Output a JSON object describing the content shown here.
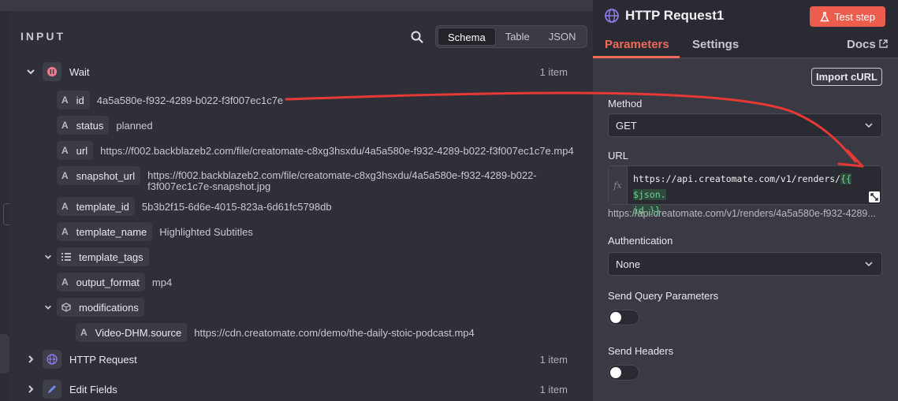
{
  "input_panel": {
    "title": "INPUT",
    "view_modes": [
      "Schema",
      "Table",
      "JSON"
    ],
    "active_view": "Schema",
    "nodes": [
      {
        "label": "Wait",
        "count": "1 item",
        "expanded": true
      },
      {
        "label": "HTTP Request",
        "count": "1 item",
        "expanded": false
      },
      {
        "label": "Edit Fields",
        "count": "1 item",
        "expanded": false
      }
    ],
    "fields": {
      "id": {
        "key": "id",
        "type": "A",
        "value": "4a5a580e-f932-4289-b022-f3f007ec1c7e"
      },
      "status": {
        "key": "status",
        "type": "A",
        "value": "planned"
      },
      "url": {
        "key": "url",
        "type": "A",
        "value": "https://f002.backblazeb2.com/file/creatomate-c8xg3hsxdu/4a5a580e-f932-4289-b022-f3f007ec1c7e.mp4"
      },
      "snapshot_url": {
        "key": "snapshot_url",
        "type": "A",
        "value_line1": "https://f002.backblazeb2.com/file/creatomate-c8xg3hsxdu/4a5a580e-f932-4289-b022-",
        "value_line2": "f3f007ec1c7e-snapshot.jpg"
      },
      "template_id": {
        "key": "template_id",
        "type": "A",
        "value": "5b3b2f15-6d6e-4015-823a-6d61fc5798db"
      },
      "template_name": {
        "key": "template_name",
        "type": "A",
        "value": "Highlighted Subtitles"
      },
      "template_tags": {
        "key": "template_tags"
      },
      "output_format": {
        "key": "output_format",
        "type": "A",
        "value": "mp4"
      },
      "modifications": {
        "key": "modifications"
      },
      "video_source": {
        "key": "Video-DHM.source",
        "type": "A",
        "value": "https://cdn.creatomate.com/demo/the-daily-stoic-podcast.mp4"
      }
    }
  },
  "right_panel": {
    "title": "HTTP Request1",
    "test_button": "Test step",
    "tabs": {
      "parameters": "Parameters",
      "settings": "Settings",
      "docs": "Docs"
    },
    "import_button": "Import cURL",
    "method": {
      "label": "Method",
      "value": "GET"
    },
    "url": {
      "label": "URL",
      "code_plain": "https://api.creatomate.com/v1/renders/",
      "code_expr_1": "{{ $json.",
      "code_expr_2": "id }}",
      "preview": "https://api.creatomate.com/v1/renders/4a5a580e-f932-4289..."
    },
    "authentication": {
      "label": "Authentication",
      "value": "None"
    },
    "send_query": {
      "label": "Send Query Parameters",
      "enabled": false
    },
    "send_headers": {
      "label": "Send Headers",
      "enabled": false
    }
  },
  "colors": {
    "accent": "#ee6b5a",
    "test_button": "#ec5d4d",
    "annotation_arrow": "#e53935"
  }
}
